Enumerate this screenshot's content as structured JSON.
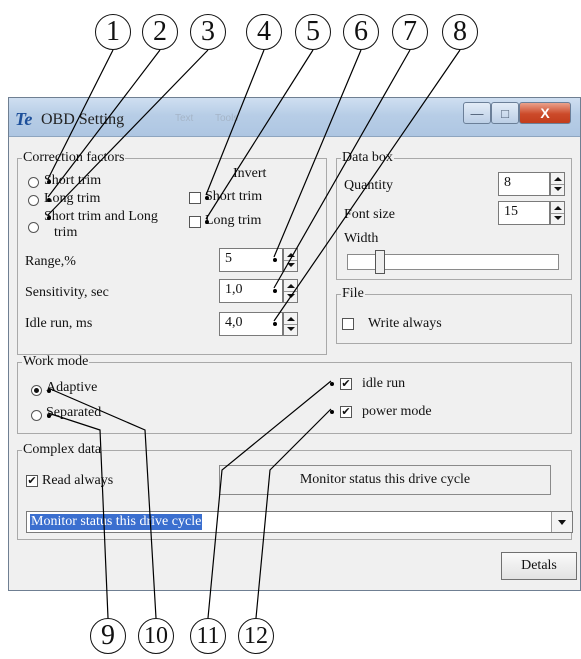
{
  "callouts": [
    "1",
    "2",
    "3",
    "4",
    "5",
    "6",
    "7",
    "8",
    "9",
    "10",
    "11",
    "12"
  ],
  "window": {
    "title": "OBD Setting",
    "app_icon": "Te",
    "title_ghost_text": [
      "Text",
      "Tools"
    ],
    "controls": {
      "minimize": "minimize-icon",
      "maximize": "maximize-icon",
      "close": "close-icon",
      "close_glyph": "X"
    }
  },
  "correction": {
    "legend": "Correction factors",
    "options": [
      {
        "label": "Short trim",
        "checked": false
      },
      {
        "label": "Long trim",
        "checked": false
      },
      {
        "label": "Short trim and Long",
        "label2": "trim",
        "checked": false
      }
    ],
    "invert_label": "Invert",
    "invert_options": [
      {
        "label": "Short trim",
        "checked": false
      },
      {
        "label": "Long trim",
        "checked": false
      }
    ],
    "range_label": "Range,%",
    "range_value": "5",
    "sensitivity_label": "Sensitivity, sec",
    "sensitivity_value": "1,0",
    "idle_label": "Idle run, ms",
    "idle_value": "4,0"
  },
  "databox": {
    "legend": "Data box",
    "quantity_label": "Quantity",
    "quantity_value": "8",
    "fontsize_label": "Font size",
    "fontsize_value": "15",
    "width_label": "Width",
    "width_slider_fraction": 0.14
  },
  "file": {
    "legend": "File",
    "write_always_label": "Write always",
    "write_always_checked": false
  },
  "workmode": {
    "legend": "Work mode",
    "adaptive_label": "Adaptive",
    "adaptive_checked": true,
    "separated_label": "Separated",
    "separated_checked": false,
    "idle_run_label": "idle run",
    "idle_run_checked": true,
    "power_mode_label": "power mode",
    "power_mode_checked": true
  },
  "complex": {
    "legend": "Complex data",
    "read_always_label": "Read always",
    "read_always_checked": true,
    "status_box": "Monitor status this drive cycle",
    "combo_selected": "Monitor status this drive cycle"
  },
  "details_button": "Detals",
  "check_glyph": "✔"
}
